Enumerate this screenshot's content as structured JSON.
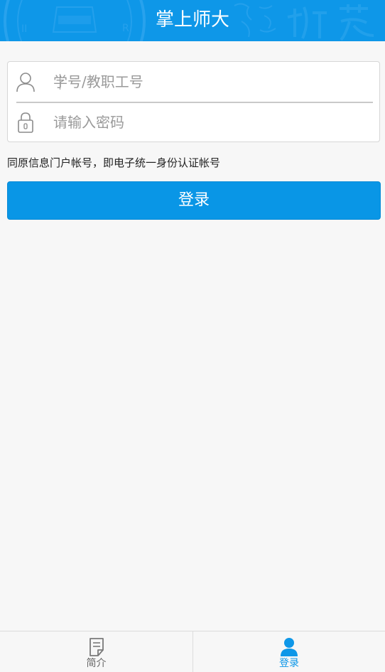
{
  "header": {
    "title": "掌上师大"
  },
  "login": {
    "username_placeholder": "学号/教职工号",
    "password_placeholder": "请输入密码",
    "hint": "同原信息门户帐号，即电子统一身份认证帐号",
    "button_label": "登录"
  },
  "tabbar": {
    "tabs": [
      {
        "label": "简介",
        "icon": "document-icon",
        "active": false
      },
      {
        "label": "登录",
        "icon": "user-icon",
        "active": true
      }
    ]
  },
  "colors": {
    "primary": "#0e97e8",
    "button": "#0996e6",
    "background": "#f7f7f7"
  }
}
